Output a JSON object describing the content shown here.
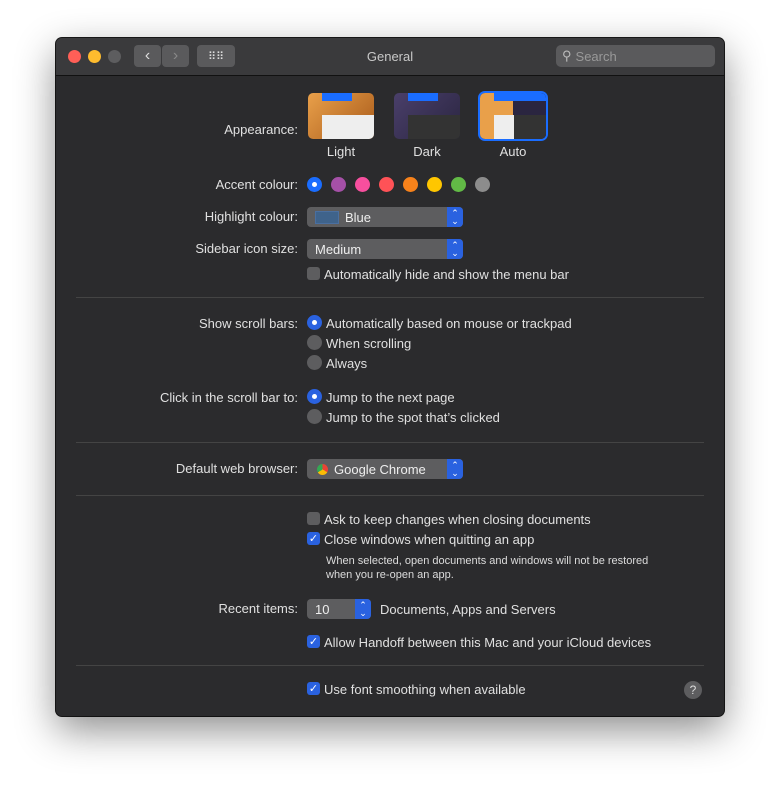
{
  "window": {
    "title": "General",
    "search_placeholder": "Search"
  },
  "appearance": {
    "label": "Appearance:",
    "options": [
      "Light",
      "Dark",
      "Auto"
    ],
    "selected": "Auto"
  },
  "accent": {
    "label": "Accent colour:",
    "colors": [
      "#1a6dff",
      "#a550a7",
      "#f74f9e",
      "#ff5257",
      "#f7821b",
      "#ffc600",
      "#62ba46",
      "#8c8c8c"
    ],
    "selected": 0
  },
  "highlight": {
    "label": "Highlight colour:",
    "value": "Blue",
    "swatch": "#3f638b"
  },
  "sidebar": {
    "label": "Sidebar icon size:",
    "value": "Medium"
  },
  "menubar": {
    "label": "Automatically hide and show the menu bar",
    "checked": false
  },
  "scrollbars": {
    "label": "Show scroll bars:",
    "options": [
      "Automatically based on mouse or trackpad",
      "When scrolling",
      "Always"
    ],
    "selected": 0
  },
  "click_scroll": {
    "label": "Click in the scroll bar to:",
    "options": [
      "Jump to the next page",
      "Jump to the spot that’s clicked"
    ],
    "selected": 0
  },
  "browser": {
    "label": "Default web browser:",
    "value": "Google Chrome"
  },
  "ask_keep": {
    "label": "Ask to keep changes when closing documents",
    "checked": false
  },
  "close_windows": {
    "label": "Close windows when quitting an app",
    "checked": true,
    "note1": "When selected, open documents and windows will not be restored",
    "note2": "when you re-open an app."
  },
  "recent": {
    "label": "Recent items:",
    "value": "10",
    "suffix": "Documents, Apps and Servers"
  },
  "handoff": {
    "label": "Allow Handoff between this Mac and your iCloud devices",
    "checked": true
  },
  "smoothing": {
    "label": "Use font smoothing when available",
    "checked": true
  },
  "help": "?"
}
